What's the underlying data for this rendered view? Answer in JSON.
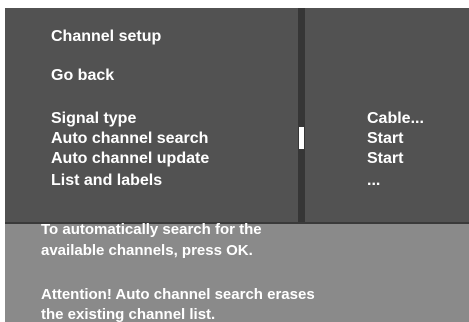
{
  "menu": {
    "title": "Channel setup",
    "back": "Go back",
    "items": [
      {
        "label": "Signal type",
        "value": "Cable..."
      },
      {
        "label": "Auto channel search",
        "value": "Start"
      },
      {
        "label": "Auto channel update",
        "value": "Start"
      },
      {
        "label": "List and labels",
        "value": "..."
      }
    ]
  },
  "info": {
    "line1": "To automatically search for the",
    "line2": "available channels, press OK.",
    "warning1": "Attention! Auto channel search erases",
    "warning2": "the existing channel list."
  },
  "colors": {
    "panel": "#525252",
    "info_background": "#8a8a8a",
    "text": "#ffffff"
  }
}
